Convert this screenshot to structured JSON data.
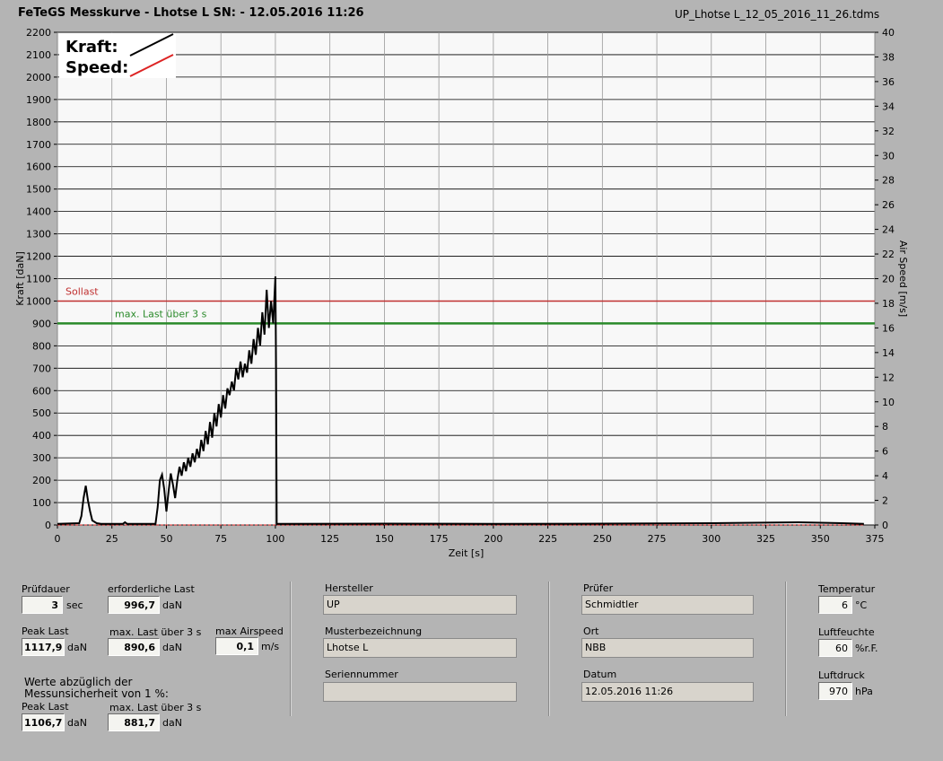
{
  "header": {
    "title": "FeTeGS Messkurve - Lhotse L  SN:  - 12.05.2016 11:26",
    "filename": "UP_Lhotse L_12_05_2016_11_26.tdms"
  },
  "legend": {
    "kraft": "Kraft:",
    "speed": "Speed:"
  },
  "colors": {
    "kraft": "#000000",
    "speed": "#dd2222",
    "sollast": "#c03030",
    "maxlast": "#2a8a2a",
    "plot_bg": "#f8f8f8"
  },
  "chart_data": {
    "type": "line",
    "xlabel": "Zeit [s]",
    "ylabel": "Kraft [daN]",
    "y2label": "Air Speed [m/s]",
    "xlim": [
      0,
      375
    ],
    "ylim": [
      0,
      2200
    ],
    "y2lim": [
      0,
      40
    ],
    "xticks": [
      0,
      25,
      50,
      75,
      100,
      125,
      150,
      175,
      200,
      225,
      250,
      275,
      300,
      325,
      350,
      375
    ],
    "yticks": [
      0,
      100,
      200,
      300,
      400,
      500,
      600,
      700,
      800,
      900,
      1000,
      1100,
      1200,
      1300,
      1400,
      1500,
      1600,
      1700,
      1800,
      1900,
      2000,
      2100,
      2200
    ],
    "y2ticks": [
      0,
      2,
      4,
      6,
      8,
      10,
      12,
      14,
      16,
      18,
      20,
      22,
      24,
      26,
      28,
      30,
      32,
      34,
      36,
      38,
      40
    ],
    "grid": true,
    "annotations": [
      {
        "label": "Sollast",
        "y": 1000
      },
      {
        "label": "max. Last über  3 s",
        "y": 900
      }
    ],
    "series": [
      {
        "name": "Kraft",
        "points": [
          [
            0,
            5
          ],
          [
            10,
            8
          ],
          [
            11,
            40
          ],
          [
            12,
            120
          ],
          [
            13,
            175
          ],
          [
            14,
            110
          ],
          [
            15,
            60
          ],
          [
            16,
            20
          ],
          [
            18,
            8
          ],
          [
            20,
            5
          ],
          [
            30,
            5
          ],
          [
            31,
            12
          ],
          [
            32,
            5
          ],
          [
            45,
            5
          ],
          [
            46,
            80
          ],
          [
            47,
            200
          ],
          [
            48,
            225
          ],
          [
            49,
            160
          ],
          [
            50,
            60
          ],
          [
            51,
            150
          ],
          [
            52,
            230
          ],
          [
            53,
            180
          ],
          [
            54,
            120
          ],
          [
            55,
            200
          ],
          [
            56,
            260
          ],
          [
            57,
            220
          ],
          [
            58,
            280
          ],
          [
            59,
            240
          ],
          [
            60,
            300
          ],
          [
            61,
            260
          ],
          [
            62,
            320
          ],
          [
            63,
            280
          ],
          [
            64,
            340
          ],
          [
            65,
            300
          ],
          [
            66,
            380
          ],
          [
            67,
            330
          ],
          [
            68,
            420
          ],
          [
            69,
            360
          ],
          [
            70,
            460
          ],
          [
            71,
            390
          ],
          [
            72,
            500
          ],
          [
            73,
            440
          ],
          [
            74,
            540
          ],
          [
            75,
            480
          ],
          [
            76,
            580
          ],
          [
            77,
            520
          ],
          [
            78,
            610
          ],
          [
            79,
            580
          ],
          [
            80,
            640
          ],
          [
            81,
            600
          ],
          [
            82,
            700
          ],
          [
            83,
            650
          ],
          [
            84,
            730
          ],
          [
            85,
            660
          ],
          [
            86,
            720
          ],
          [
            87,
            680
          ],
          [
            88,
            780
          ],
          [
            89,
            720
          ],
          [
            90,
            830
          ],
          [
            91,
            760
          ],
          [
            92,
            880
          ],
          [
            93,
            800
          ],
          [
            94,
            950
          ],
          [
            95,
            850
          ],
          [
            96,
            1050
          ],
          [
            97,
            880
          ],
          [
            98,
            1000
          ],
          [
            99,
            900
          ],
          [
            100,
            1110
          ],
          [
            100.3,
            700
          ],
          [
            100.6,
            5
          ],
          [
            150,
            6
          ],
          [
            200,
            5
          ],
          [
            250,
            6
          ],
          [
            300,
            8
          ],
          [
            320,
            10
          ],
          [
            340,
            12
          ],
          [
            360,
            8
          ],
          [
            370,
            5
          ]
        ]
      },
      {
        "name": "Speed",
        "points": [
          [
            0,
            0
          ],
          [
            370,
            0
          ]
        ]
      }
    ]
  },
  "panel": {
    "pruefdauer": {
      "label": "Prüfdauer",
      "value": "3",
      "unit": "sec"
    },
    "erf_last": {
      "label": "erforderliche Last",
      "value": "996,7",
      "unit": "daN"
    },
    "peak_last": {
      "label": "Peak Last",
      "value": "1117,9",
      "unit": "daN"
    },
    "max_last": {
      "label": "max. Last über  3 s",
      "value": "890,6",
      "unit": "daN"
    },
    "max_airspeed": {
      "label": "max Airspeed",
      "value": "0,1",
      "unit": "m/s"
    },
    "werte_note": "Werte abzüglich der Messunsicherheit von 1  %:",
    "peak_last2": {
      "label": "Peak Last",
      "value": "1106,7",
      "unit": "daN"
    },
    "max_last2": {
      "label": "max. Last über  3 s",
      "value": "881,7",
      "unit": "daN"
    },
    "hersteller": {
      "label": "Hersteller",
      "value": "UP"
    },
    "muster": {
      "label": "Musterbezeichnung",
      "value": "Lhotse L"
    },
    "serien": {
      "label": "Seriennummer",
      "value": ""
    },
    "pruefer": {
      "label": "Prüfer",
      "value": "Schmidtler"
    },
    "ort": {
      "label": "Ort",
      "value": "NBB"
    },
    "datum": {
      "label": "Datum",
      "value": "12.05.2016 11:26"
    },
    "temperatur": {
      "label": "Temperatur",
      "value": "6",
      "unit": "°C"
    },
    "luftfeuchte": {
      "label": "Luftfeuchte",
      "value": "60",
      "unit": "%r.F."
    },
    "luftdruck": {
      "label": "Luftdruck",
      "value": "970",
      "unit": "hPa"
    }
  }
}
